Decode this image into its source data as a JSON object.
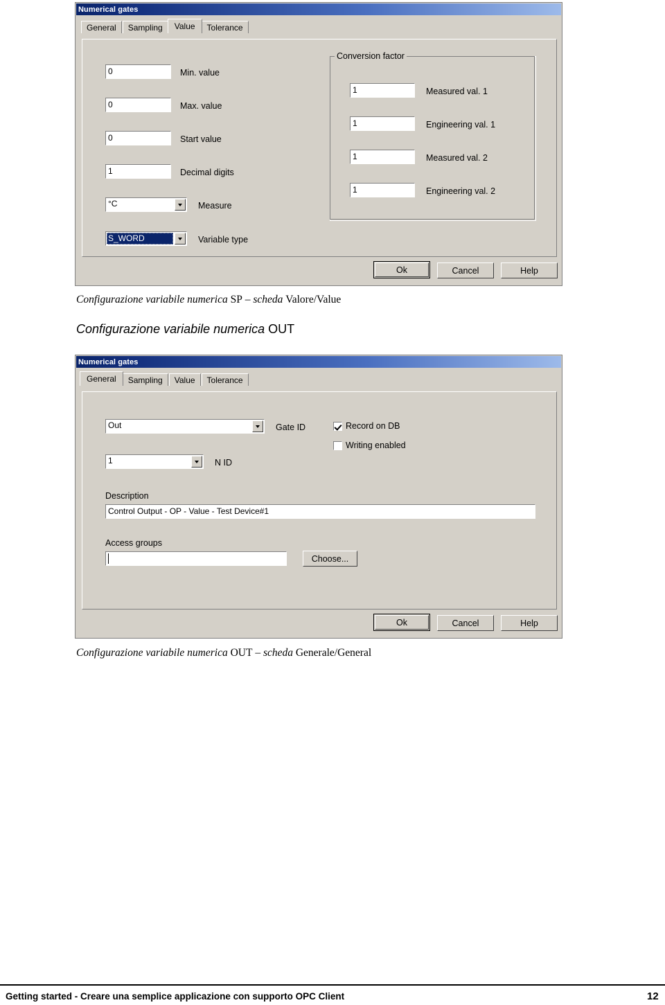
{
  "page": {
    "footer_text": "Getting started - Creare una semplice applicazione con supporto OPC Client",
    "footer_page": "12"
  },
  "captions": {
    "value_tab_caption_italic": "Configurazione variabile numerica ",
    "value_tab_caption_sp": "SP",
    "value_tab_caption_dash": " – ",
    "value_tab_caption_scheda": "scheda ",
    "value_tab_caption_tabname": "Valore/Value",
    "heading_italic": "Configurazione variabile numerica ",
    "heading_upright": "OUT",
    "general_tab_caption_italic": "Configurazione variabile numerica ",
    "general_tab_caption_out": "OUT",
    "general_tab_caption_dash": " – ",
    "general_tab_caption_scheda": "scheda ",
    "general_tab_caption_tabname": "Generale/General"
  },
  "dialog_value": {
    "title": "Numerical gates",
    "tabs": [
      {
        "label": "General",
        "active": false
      },
      {
        "label": "Sampling",
        "active": false
      },
      {
        "label": "Value",
        "active": true
      },
      {
        "label": "Tolerance",
        "active": false
      }
    ],
    "fields": [
      {
        "value": "0",
        "label": "Min. value"
      },
      {
        "value": "0",
        "label": "Max. value"
      },
      {
        "value": "0",
        "label": "Start value"
      },
      {
        "value": "1",
        "label": "Decimal digits"
      }
    ],
    "measure": {
      "value": "°C",
      "label": "Measure"
    },
    "variable_type": {
      "value": "S_WORD",
      "label": "Variable type"
    },
    "conversion_factor": {
      "title": "Conversion factor",
      "rows": [
        {
          "value": "1",
          "label": "Measured val. 1"
        },
        {
          "value": "1",
          "label": "Engineering val. 1"
        },
        {
          "value": "1",
          "label": "Measured val. 2"
        },
        {
          "value": "1",
          "label": "Engineering val. 2"
        }
      ]
    },
    "buttons": {
      "ok": "Ok",
      "cancel": "Cancel",
      "help": "Help"
    }
  },
  "dialog_general": {
    "title": "Numerical gates",
    "tabs": [
      {
        "label": "General",
        "active": true
      },
      {
        "label": "Sampling",
        "active": false
      },
      {
        "label": "Value",
        "active": false
      },
      {
        "label": "Tolerance",
        "active": false
      }
    ],
    "gate_id": {
      "value": "Out",
      "label": "Gate ID"
    },
    "n_id": {
      "value": "1",
      "label": "N ID"
    },
    "checkboxes": [
      {
        "label": "Record on DB",
        "checked": true
      },
      {
        "label": "Writing enabled",
        "checked": false
      }
    ],
    "description": {
      "label": "Description",
      "value": "Control Output - OP - Value - Test Device#1"
    },
    "access_groups": {
      "label": "Access groups",
      "value": "",
      "button": "Choose..."
    },
    "buttons": {
      "ok": "Ok",
      "cancel": "Cancel",
      "help": "Help"
    }
  },
  "colors": {
    "dialog_face": "#d4d0c8",
    "titlebar_start": "#0a246a",
    "titlebar_end": "#9dbaea",
    "selection": "#0a246a"
  }
}
